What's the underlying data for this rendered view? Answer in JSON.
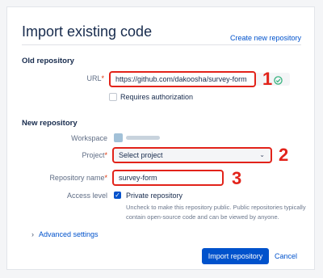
{
  "header": {
    "title": "Import existing code",
    "create_link": "Create new repository"
  },
  "old_repo": {
    "section_title": "Old repository",
    "url_label": "URL",
    "required_mark": "*",
    "url_value": "https://github.com/dakoosha/survey-form",
    "requires_auth_label": "Requires authorization",
    "url_valid_icon": "check-circle-icon"
  },
  "new_repo": {
    "section_title": "New repository",
    "workspace_label": "Workspace",
    "project_label": "Project",
    "project_value": "Select project",
    "repo_name_label": "Repository name",
    "repo_name_value": "survey-form",
    "access_label": "Access level",
    "private_label": "Private repository",
    "private_checked": true,
    "private_help": "Uncheck to make this repository public. Public repositories typically contain open-source code and can be viewed by anyone."
  },
  "advanced": {
    "label": "Advanced settings"
  },
  "actions": {
    "import_label": "Import repository",
    "cancel_label": "Cancel"
  },
  "annotations": [
    "1",
    "2",
    "3"
  ],
  "colors": {
    "accent": "#0052cc",
    "annotation": "#e2231a",
    "valid": "#36b37e"
  }
}
